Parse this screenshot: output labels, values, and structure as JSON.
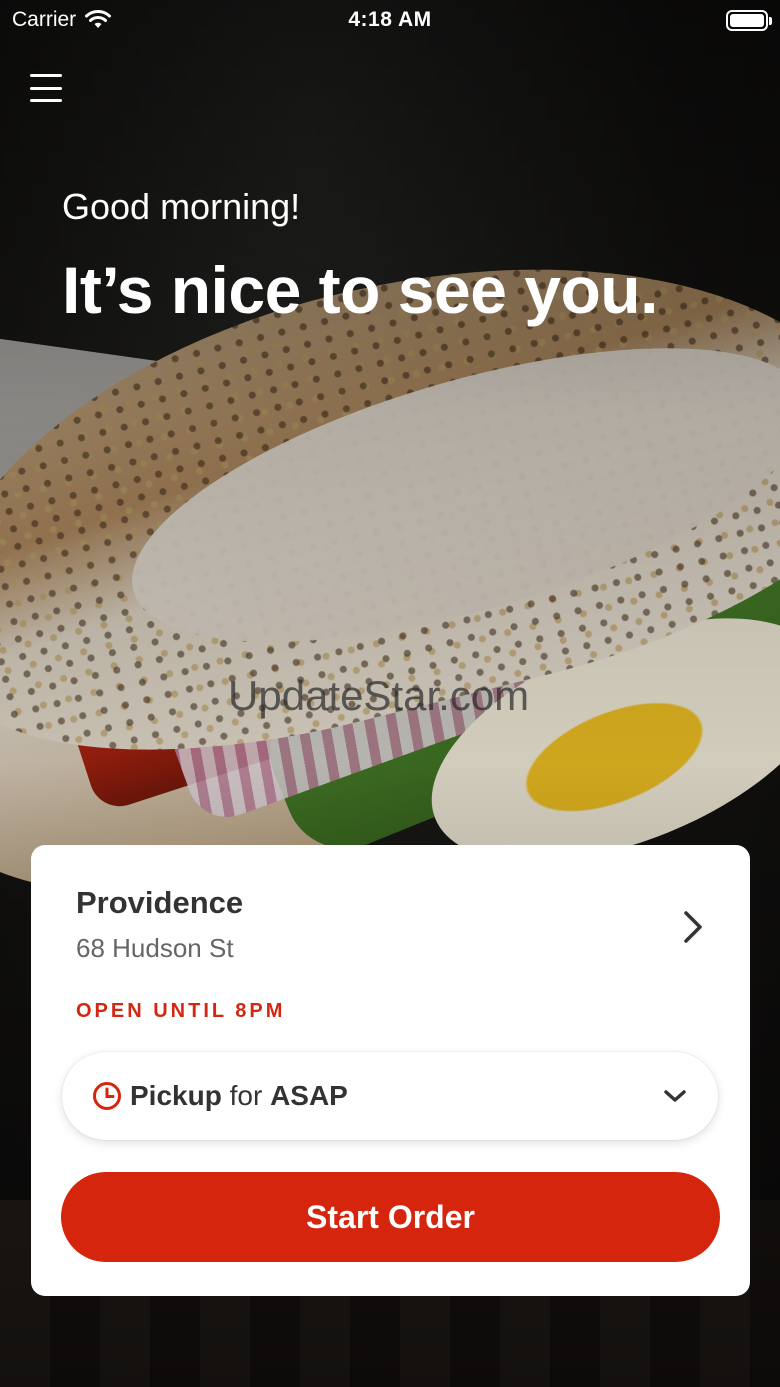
{
  "status_bar": {
    "carrier": "Carrier",
    "time": "4:18 AM",
    "wifi_icon": "wifi-icon",
    "battery_icon": "battery-icon"
  },
  "header": {
    "menu_icon": "hamburger-menu-icon"
  },
  "hero": {
    "greeting": "Good morning!",
    "headline": "It’s nice to see you."
  },
  "watermark": "UpdateStar.com",
  "store_card": {
    "name": "Providence",
    "address": "68 Hudson St",
    "chevron_icon": "chevron-right-icon",
    "hours": "OPEN UNTIL 8PM",
    "order_mode": {
      "icon": "clock-icon",
      "mode": "Pickup",
      "connector": "for",
      "time": "ASAP",
      "dropdown_icon": "chevron-down-icon"
    },
    "start_button": "Start Order"
  },
  "colors": {
    "accent": "#d6250d",
    "text_dark": "#333333",
    "text_muted": "#666666"
  }
}
